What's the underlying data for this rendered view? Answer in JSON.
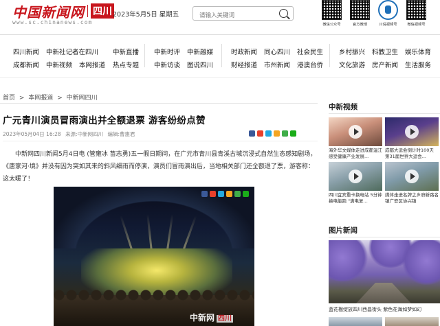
{
  "header": {
    "logo_cn": "中国新闻网",
    "logo_region": "四川",
    "url": "www.sc.chinanews.com",
    "date": "2023年5月5日 星期五",
    "search_placeholder": "请输入关键词",
    "qr_codes": [
      {
        "caption": "微信公众号"
      },
      {
        "caption": "官方微博"
      },
      {
        "caption": "川说视频号"
      },
      {
        "caption": "微信视频号"
      }
    ]
  },
  "nav": {
    "items": [
      {
        "label": "四川新闻"
      },
      {
        "label": "中新社记者在四川"
      },
      {
        "label": "中新直播"
      },
      {
        "label": "成都新闻"
      },
      {
        "label": "中新视频"
      },
      {
        "label": "本网报道"
      },
      {
        "label": "热点专题"
      },
      {
        "label": "中新时评"
      },
      {
        "label": "中新融媒"
      },
      {
        "label": "中新访谈"
      },
      {
        "label": "图说四川"
      },
      {
        "label": "时政新闻"
      },
      {
        "label": "同心四川"
      },
      {
        "label": "社会民生"
      },
      {
        "label": "财经报道"
      },
      {
        "label": "市州新闻"
      },
      {
        "label": "港澳台侨"
      },
      {
        "label": "乡村振兴"
      },
      {
        "label": "科教卫生"
      },
      {
        "label": "娱乐体育"
      },
      {
        "label": "文化旅游"
      },
      {
        "label": "房产新闻"
      },
      {
        "label": "生活服务"
      }
    ]
  },
  "breadcrumb": [
    "首页",
    ">",
    "本网报道",
    ">",
    "中新网四川"
  ],
  "article": {
    "title": "广元青川演员冒雨演出并全额退票 游客纷纷点赞",
    "time": "2023年05月04日 16:28",
    "source": "来源:中新网四川",
    "editor": "编辑:曹惠君",
    "body": "中新网四川新闻5月4日电 (管雍冰 苗志勇)五一假日期间，在广元市青川县青溪古城沉浸式自然生态感知剧场，《唐家河·境》并没有因为突如其来的斜风细雨而停演，演员们冒雨演出后，当地相关部门还全额退了票，游客称：这太暖了！",
    "photo_watermark": "中新网",
    "photo_watermark_region": "四川"
  },
  "share_colors": [
    "#3b5998",
    "#e8402b",
    "#23a8e0",
    "#f5a623",
    "#3fae49",
    "#1aad19"
  ],
  "sidebar": {
    "video_title": "中新视频",
    "videos": [
      {
        "caption": "海外华文媒体走进成都温江 感受健康产业发展..."
      },
      {
        "caption": "成都大运会倒计时100天 第31届世界大运会..."
      },
      {
        "caption": "四川宜宾重卡换电站 5分钟换电能跑 \"满电复..."
      },
      {
        "caption": "媒体走进名牌之乡府新路名镇广安区协兴镇"
      }
    ],
    "pic_title": "图片新闻",
    "pic_caption": "蓝花楹绽放四川西昌街头 紫色花海如梦如幻"
  }
}
